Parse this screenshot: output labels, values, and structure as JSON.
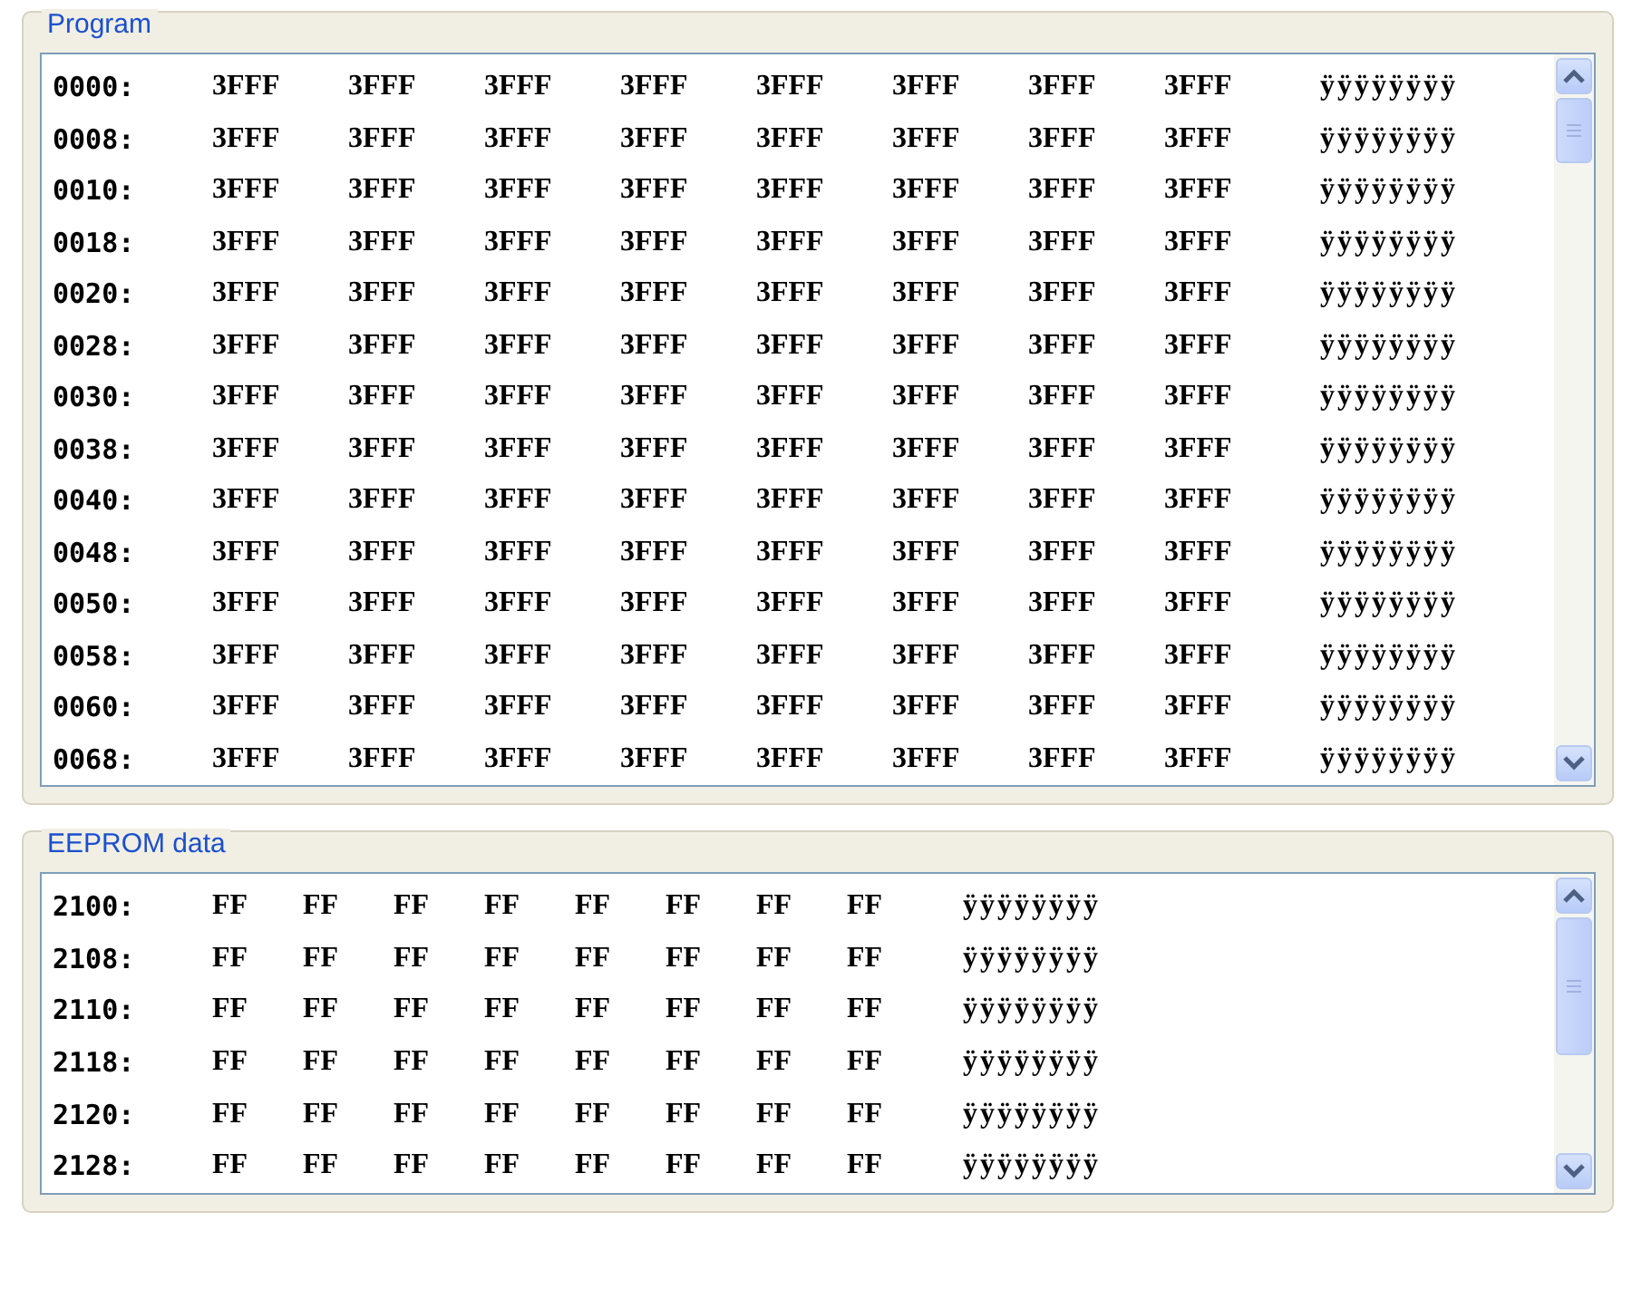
{
  "program": {
    "title": "Program",
    "rows": [
      {
        "address": "0000:",
        "words": [
          "3FFF",
          "3FFF",
          "3FFF",
          "3FFF",
          "3FFF",
          "3FFF",
          "3FFF",
          "3FFF"
        ],
        "ascii": "ÿÿÿÿÿÿÿÿ"
      },
      {
        "address": "0008:",
        "words": [
          "3FFF",
          "3FFF",
          "3FFF",
          "3FFF",
          "3FFF",
          "3FFF",
          "3FFF",
          "3FFF"
        ],
        "ascii": "ÿÿÿÿÿÿÿÿ"
      },
      {
        "address": "0010:",
        "words": [
          "3FFF",
          "3FFF",
          "3FFF",
          "3FFF",
          "3FFF",
          "3FFF",
          "3FFF",
          "3FFF"
        ],
        "ascii": "ÿÿÿÿÿÿÿÿ"
      },
      {
        "address": "0018:",
        "words": [
          "3FFF",
          "3FFF",
          "3FFF",
          "3FFF",
          "3FFF",
          "3FFF",
          "3FFF",
          "3FFF"
        ],
        "ascii": "ÿÿÿÿÿÿÿÿ"
      },
      {
        "address": "0020:",
        "words": [
          "3FFF",
          "3FFF",
          "3FFF",
          "3FFF",
          "3FFF",
          "3FFF",
          "3FFF",
          "3FFF"
        ],
        "ascii": "ÿÿÿÿÿÿÿÿ"
      },
      {
        "address": "0028:",
        "words": [
          "3FFF",
          "3FFF",
          "3FFF",
          "3FFF",
          "3FFF",
          "3FFF",
          "3FFF",
          "3FFF"
        ],
        "ascii": "ÿÿÿÿÿÿÿÿ"
      },
      {
        "address": "0030:",
        "words": [
          "3FFF",
          "3FFF",
          "3FFF",
          "3FFF",
          "3FFF",
          "3FFF",
          "3FFF",
          "3FFF"
        ],
        "ascii": "ÿÿÿÿÿÿÿÿ"
      },
      {
        "address": "0038:",
        "words": [
          "3FFF",
          "3FFF",
          "3FFF",
          "3FFF",
          "3FFF",
          "3FFF",
          "3FFF",
          "3FFF"
        ],
        "ascii": "ÿÿÿÿÿÿÿÿ"
      },
      {
        "address": "0040:",
        "words": [
          "3FFF",
          "3FFF",
          "3FFF",
          "3FFF",
          "3FFF",
          "3FFF",
          "3FFF",
          "3FFF"
        ],
        "ascii": "ÿÿÿÿÿÿÿÿ"
      },
      {
        "address": "0048:",
        "words": [
          "3FFF",
          "3FFF",
          "3FFF",
          "3FFF",
          "3FFF",
          "3FFF",
          "3FFF",
          "3FFF"
        ],
        "ascii": "ÿÿÿÿÿÿÿÿ"
      },
      {
        "address": "0050:",
        "words": [
          "3FFF",
          "3FFF",
          "3FFF",
          "3FFF",
          "3FFF",
          "3FFF",
          "3FFF",
          "3FFF"
        ],
        "ascii": "ÿÿÿÿÿÿÿÿ"
      },
      {
        "address": "0058:",
        "words": [
          "3FFF",
          "3FFF",
          "3FFF",
          "3FFF",
          "3FFF",
          "3FFF",
          "3FFF",
          "3FFF"
        ],
        "ascii": "ÿÿÿÿÿÿÿÿ"
      },
      {
        "address": "0060:",
        "words": [
          "3FFF",
          "3FFF",
          "3FFF",
          "3FFF",
          "3FFF",
          "3FFF",
          "3FFF",
          "3FFF"
        ],
        "ascii": "ÿÿÿÿÿÿÿÿ"
      },
      {
        "address": "0068:",
        "words": [
          "3FFF",
          "3FFF",
          "3FFF",
          "3FFF",
          "3FFF",
          "3FFF",
          "3FFF",
          "3FFF"
        ],
        "ascii": "ÿÿÿÿÿÿÿÿ"
      }
    ]
  },
  "eeprom": {
    "title": "EEPROM data",
    "rows": [
      {
        "address": "2100:",
        "bytes": [
          "FF",
          "FF",
          "FF",
          "FF",
          "FF",
          "FF",
          "FF",
          "FF"
        ],
        "ascii": "ÿÿÿÿÿÿÿÿ"
      },
      {
        "address": "2108:",
        "bytes": [
          "FF",
          "FF",
          "FF",
          "FF",
          "FF",
          "FF",
          "FF",
          "FF"
        ],
        "ascii": "ÿÿÿÿÿÿÿÿ"
      },
      {
        "address": "2110:",
        "bytes": [
          "FF",
          "FF",
          "FF",
          "FF",
          "FF",
          "FF",
          "FF",
          "FF"
        ],
        "ascii": "ÿÿÿÿÿÿÿÿ"
      },
      {
        "address": "2118:",
        "bytes": [
          "FF",
          "FF",
          "FF",
          "FF",
          "FF",
          "FF",
          "FF",
          "FF"
        ],
        "ascii": "ÿÿÿÿÿÿÿÿ"
      },
      {
        "address": "2120:",
        "bytes": [
          "FF",
          "FF",
          "FF",
          "FF",
          "FF",
          "FF",
          "FF",
          "FF"
        ],
        "ascii": "ÿÿÿÿÿÿÿÿ"
      },
      {
        "address": "2128:",
        "bytes": [
          "FF",
          "FF",
          "FF",
          "FF",
          "FF",
          "FF",
          "FF",
          "FF"
        ],
        "ascii": "ÿÿÿÿÿÿÿÿ"
      }
    ]
  }
}
